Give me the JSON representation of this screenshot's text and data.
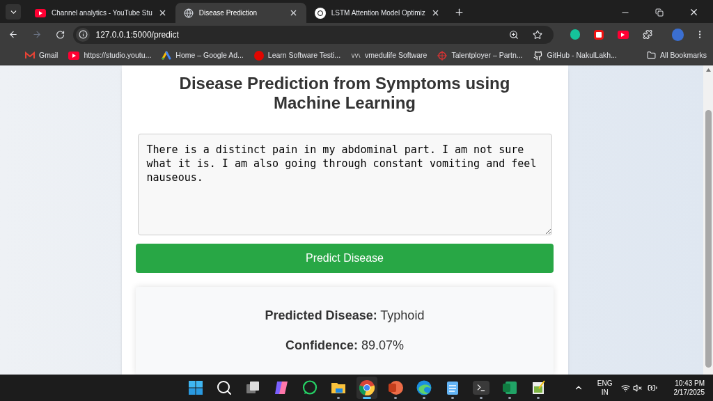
{
  "tabs": [
    {
      "title": "Channel analytics - YouTube Stu",
      "kind": "youtube",
      "selected": false
    },
    {
      "title": "Disease Prediction",
      "kind": "globe",
      "selected": true
    },
    {
      "title": "LSTM Attention Model Optimiz",
      "kind": "openai",
      "selected": false
    }
  ],
  "address": "127.0.0.1:5000/predict",
  "bookmarks": [
    {
      "label": "Gmail",
      "kind": "gmail"
    },
    {
      "label": "https://studio.youtu...",
      "kind": "youtube"
    },
    {
      "label": "Home – Google Ad...",
      "kind": "ads"
    },
    {
      "label": "Learn Software Testi...",
      "kind": "red"
    },
    {
      "label": "vmedulife Software",
      "kind": "vm"
    },
    {
      "label": "Talentployer – Partn...",
      "kind": "target"
    },
    {
      "label": "GitHub - NakulLakh...",
      "kind": "github"
    }
  ],
  "all_bookmarks": "All Bookmarks",
  "page": {
    "heading": "Disease Prediction from Symptoms using Machine Learning",
    "symptoms": "There is a distinct pain in my abdominal part. I am not sure what it is. I am also going through constant vomiting and feel nauseous.",
    "button": "Predict Disease",
    "result": [
      "**Predicted Disease:** Typhoid",
      "**Confidence:** 89.07%"
    ]
  },
  "taskbar": {
    "apps": [
      {
        "kind": "start",
        "open": false,
        "selected": false
      },
      {
        "kind": "search",
        "open": false,
        "selected": false
      },
      {
        "kind": "taskview",
        "open": false,
        "selected": false
      },
      {
        "kind": "copilot",
        "open": false,
        "selected": false
      },
      {
        "kind": "whatsapp",
        "open": false,
        "selected": false
      },
      {
        "kind": "files",
        "open": true,
        "selected": false
      },
      {
        "kind": "chrome",
        "open": true,
        "selected": true
      },
      {
        "kind": "powerpoint",
        "open": true,
        "selected": false
      },
      {
        "kind": "edge",
        "open": true,
        "selected": false
      },
      {
        "kind": "notepad",
        "open": true,
        "selected": false
      },
      {
        "kind": "terminal",
        "open": true,
        "selected": false
      },
      {
        "kind": "excel",
        "open": true,
        "selected": false
      },
      {
        "kind": "paint",
        "open": true,
        "selected": false
      }
    ],
    "language": "ENG",
    "region": "IN",
    "time": "10:43 PM",
    "date": "2/17/2025"
  }
}
